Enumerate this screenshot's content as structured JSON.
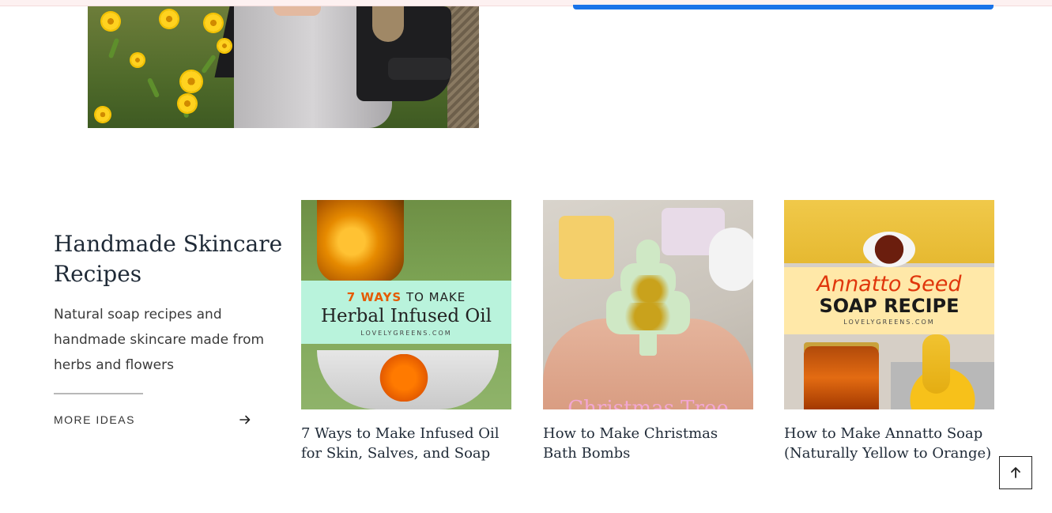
{
  "section": {
    "title": "Handmade Skincare Recipes",
    "description": "Natural soap recipes and handmade skincare made from herbs and flowers",
    "more_label": "MORE IDEAS"
  },
  "cards": [
    {
      "caption": "7 Ways to Make Infused Oil for Skin, Salves, and Soap",
      "overlay": {
        "highlight": "7 WAYS",
        "rest": " TO MAKE",
        "title": "Herbal Infused Oil",
        "site": "LOVELYGREENS.COM"
      }
    },
    {
      "caption": "How to Make Christmas Bath Bombs",
      "overlay": {
        "title": "Christmas Tree"
      }
    },
    {
      "caption": "How to Make Annatto Soap (Naturally Yellow to Orange)",
      "overlay": {
        "script": "Annatto Seed",
        "title": "SOAP RECIPE",
        "site": "LOVELYGREENS.COM"
      }
    }
  ],
  "icons": {
    "more_arrow": "arrow-right-icon",
    "back_to_top": "arrow-up-icon"
  },
  "colors": {
    "accent_blue": "#1a73e8",
    "heading": "#1f2a37",
    "mint_banner": "#b9f3dc",
    "annatto_red": "#e0360c"
  }
}
